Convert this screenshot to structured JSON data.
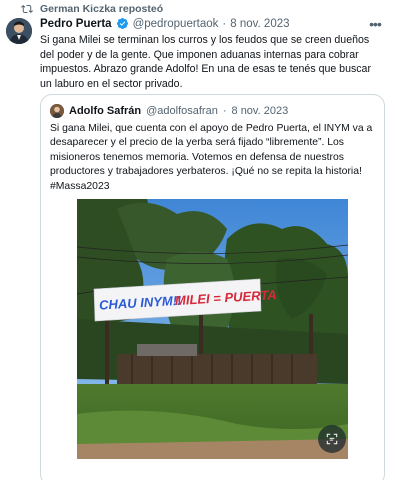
{
  "repost": {
    "text": "German Kiczka reposteó",
    "icon": "repost-icon"
  },
  "tweet": {
    "author_name": "Pedro Puerta",
    "handle": "@pedropuertaok",
    "separator": "·",
    "date": "8 nov. 2023",
    "text": "Si gana Milei se terminan los curros y los feudos que se creen dueños del poder y de la gente. Que imponen aduanas internas para cobrar impuestos. Abrazo grande Adolfo! En una de esas te tenés que buscar un laburo en el sector privado."
  },
  "quote": {
    "author_name": "Adolfo Safrán",
    "handle": "@adolfosafran",
    "separator": "·",
    "date": "8 nov. 2023",
    "text": "Si gana Milei, que cuenta con el apoyo de Pedro Puerta, el INYM va a desaparecer y el precio de la yerba será fijado “libremente”. Los misioneros tenemos memoria. Votemos en defensa de nuestros productores y trabajadores yerbateros. ¡Qué no se repita la historia! #Massa2023",
    "banner": {
      "left": "CHAU INYM!!",
      "right": "MILEI = PUERTA"
    }
  },
  "colors": {
    "verified": "#1d9bf0",
    "banner_blue": "#2a5bd7",
    "banner_red": "#d8283a",
    "muted": "#536471"
  }
}
